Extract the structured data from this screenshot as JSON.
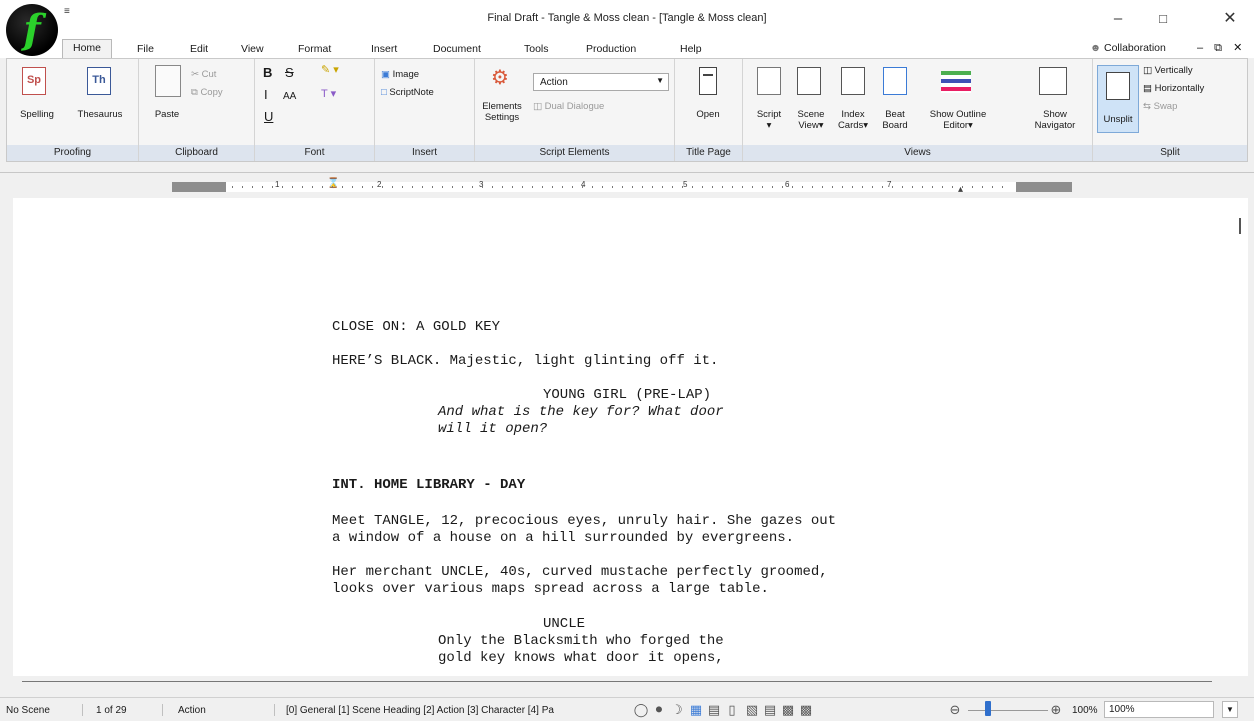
{
  "window": {
    "title": "Final Draft - Tangle & Moss clean - [Tangle & Moss clean]",
    "qat_label": "≡"
  },
  "tabs": [
    "Home",
    "File",
    "Edit",
    "View",
    "Format",
    "Insert",
    "Document",
    "Tools",
    "Production",
    "Help"
  ],
  "collaboration_label": "Collaboration",
  "ribbon": {
    "proofing": {
      "label": "Proofing",
      "spelling": "Spelling",
      "thesaurus": "Thesaurus",
      "sp_glyph": "Sp",
      "th_glyph": "Th"
    },
    "clipboard": {
      "label": "Clipboard",
      "paste": "Paste",
      "cut": "Cut",
      "copy": "Copy"
    },
    "font": {
      "label": "Font",
      "bold": "B",
      "strike": "S",
      "italic": "I",
      "caps": "AA",
      "underline": "U",
      "color": "T"
    },
    "insert": {
      "label": "Insert",
      "image": "Image",
      "scriptnote": "ScriptNote"
    },
    "script_elements": {
      "label": "Script Elements",
      "elements_settings_1": "Elements",
      "elements_settings_2": "Settings",
      "element_value": "Action",
      "dual_dialogue": "Dual Dialogue"
    },
    "title_page": {
      "label": "Title Page",
      "open": "Open"
    },
    "views": {
      "label": "Views",
      "script": "Script",
      "scene_view_1": "Scene",
      "scene_view_2": "View▾",
      "index_cards_1": "Index",
      "index_cards_2": "Cards▾",
      "beat_board_1": "Beat",
      "beat_board_2": "Board",
      "outline_1": "Show Outline",
      "outline_2": "Editor▾",
      "navigator_1": "Show",
      "navigator_2": "Navigator"
    },
    "split": {
      "label": "Split",
      "unsplit": "Unsplit",
      "vertically": "Vertically",
      "horizontally": "Horizontally",
      "swap": "Swap"
    }
  },
  "ruler": {
    "numbers": [
      "1",
      "2",
      "3",
      "4",
      "5",
      "6",
      "7"
    ]
  },
  "script": {
    "line1": "CLOSE ON: A GOLD KEY",
    "line2": "HERE’S BLACK. Majestic, light glinting off it.",
    "char1": "YOUNG GIRL (PRE-LAP)",
    "dlg1a": "And what is the key for? What door",
    "dlg1b": "will it open?",
    "heading": "INT. HOME LIBRARY - DAY",
    "act2a": "Meet TANGLE, 12, precocious eyes, unruly hair. She gazes out",
    "act2b": "a window of a house on a hill surrounded by evergreens.",
    "act3a": "Her merchant UNCLE, 40s, curved mustache perfectly groomed,",
    "act3b": "looks over various maps spread across a large table.",
    "char2": "UNCLE",
    "dlg2a": "Only the Blacksmith who forged the",
    "dlg2b": "gold key knows what door it opens,"
  },
  "status": {
    "scene": "No Scene",
    "page": "1  of  29",
    "element": "Action",
    "shortcuts": "[0] General [1] Scene Heading [2] Action [3] Character [4] Pa",
    "zoom_pct": "100%",
    "zoom_box": "100%"
  }
}
